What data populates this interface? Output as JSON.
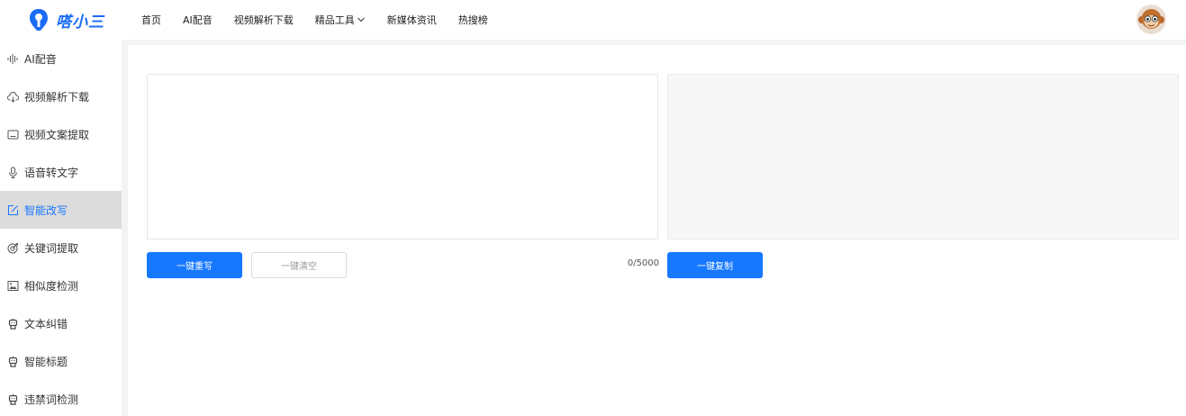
{
  "header": {
    "brand": "嗒小三",
    "brand_color": "#1a6cf5",
    "nav": [
      {
        "label": "首页"
      },
      {
        "label": "AI配音"
      },
      {
        "label": "视频解析下载"
      },
      {
        "label": "精品工具",
        "icon": "chevron-down-icon"
      },
      {
        "label": "新媒体资讯"
      },
      {
        "label": "热搜榜"
      }
    ],
    "avatar_icon": "monkey-avatar"
  },
  "sidebar": {
    "active_index": 4,
    "active_color": "#1677ff",
    "items": [
      {
        "label": "AI配音",
        "icon": "waveform-icon"
      },
      {
        "label": "视频解析下载",
        "icon": "cloud-download-icon"
      },
      {
        "label": "视频文案提取",
        "icon": "video-text-icon"
      },
      {
        "label": "语音转文字",
        "icon": "microphone-icon"
      },
      {
        "label": "智能改写",
        "icon": "edit-icon"
      },
      {
        "label": "关键词提取",
        "icon": "target-icon"
      },
      {
        "label": "相似度检测",
        "icon": "image-compare-icon"
      },
      {
        "label": "文本纠错",
        "icon": "robot-icon"
      },
      {
        "label": "智能标题",
        "icon": "robot-icon"
      },
      {
        "label": "违禁词检测",
        "icon": "robot-icon"
      }
    ]
  },
  "editor": {
    "input_value": "",
    "output_value": "",
    "counter": "0/5000",
    "rewrite_label": "一键重写",
    "clear_label": "一键清空",
    "copy_label": "一键复制"
  }
}
